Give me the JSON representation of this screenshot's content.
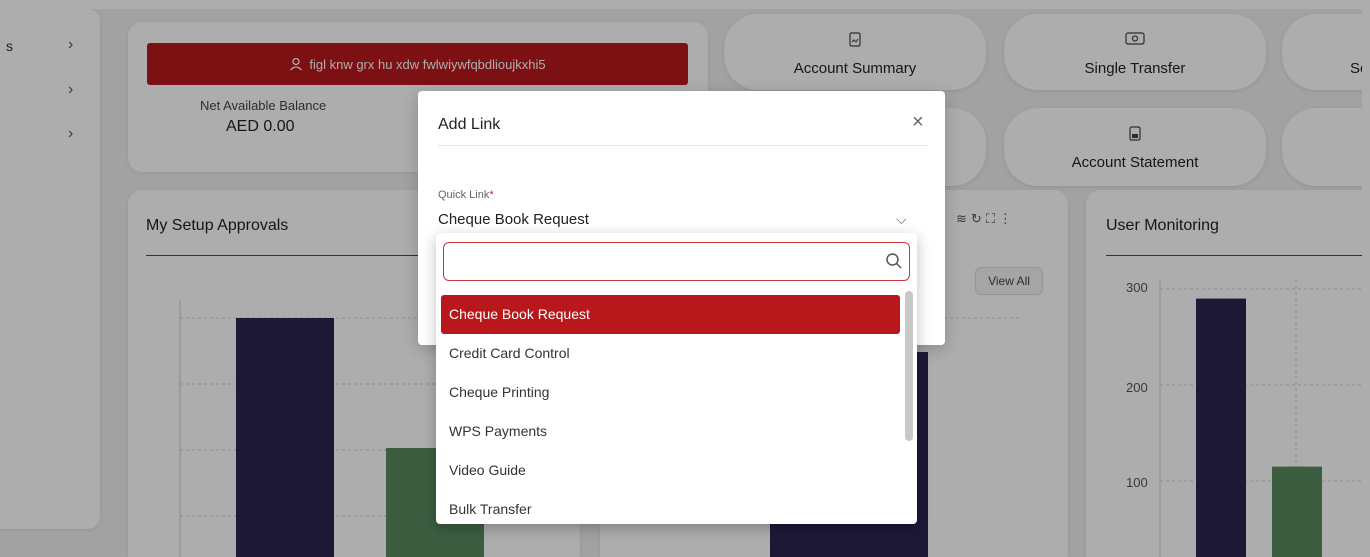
{
  "sidebar": {
    "items": [
      {
        "label": "s",
        "chevron": "›"
      },
      {
        "label": "",
        "chevron": "›"
      },
      {
        "label": "",
        "chevron": "›"
      }
    ]
  },
  "account": {
    "user_name": "figl knw grx hu xdw fwlwiywfqbdlioujkxhi5",
    "balance_label": "Net Available Balance",
    "balance_value": "AED 0.00"
  },
  "quick_actions": [
    {
      "label": "Account Summary",
      "icon": "document-icon"
    },
    {
      "label": "Single Transfer",
      "icon": "money-icon"
    },
    {
      "label": "Se",
      "icon": ""
    },
    {
      "label": "Account Statement",
      "icon": "statement-icon"
    }
  ],
  "panels": {
    "setup_approvals_title": "My Setup Approvals",
    "view_all": "View All",
    "user_monitoring_title": "User Monitoring"
  },
  "chart_data": {
    "type": "bar",
    "title": "User Monitoring",
    "yticks": [
      "300",
      "200",
      "100"
    ],
    "ylim": [
      0,
      300
    ],
    "series": [
      {
        "values": [
          290
        ],
        "color": "#2b2450"
      },
      {
        "values": [
          115
        ],
        "color": "#5b8a5f"
      }
    ]
  },
  "modal": {
    "title": "Add Link",
    "close": "×",
    "field_label": "Quick Link",
    "required_mark": "*",
    "selected_value": "Cheque Book Request",
    "chevron": "⌵"
  },
  "dropdown": {
    "search_placeholder": "",
    "options": [
      "Cheque Book Request",
      "Credit Card Control",
      "Cheque Printing",
      "WPS Payments",
      "Video Guide",
      "Bulk Transfer"
    ],
    "selected_index": 0
  },
  "colors": {
    "accent": "#b8181b",
    "bar_dark": "#2b2450",
    "bar_green": "#5b8a5f"
  }
}
